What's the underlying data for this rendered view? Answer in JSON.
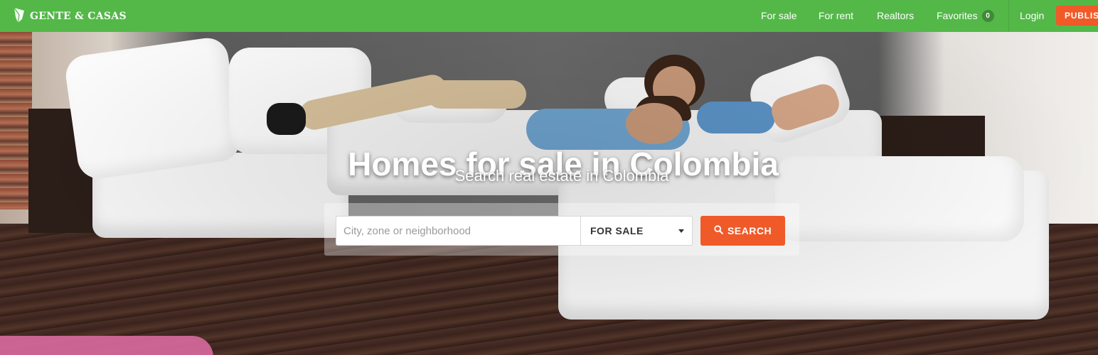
{
  "brand": {
    "name": "GENTE & CASAS",
    "icon": "leaf-logo-icon"
  },
  "nav": {
    "for_sale": "For sale",
    "for_rent": "For rent",
    "realtors": "Realtors",
    "favorites": "Favorites",
    "favorites_count": "0",
    "login": "Login",
    "publish": "PUBLISH"
  },
  "hero": {
    "title": "Homes for sale in Colombia",
    "subtitle": "Search real estate in Colombia"
  },
  "search": {
    "placeholder": "City, zone or neighborhood",
    "value": "",
    "type_selected": "FOR SALE",
    "button_label": "SEARCH",
    "button_icon": "search-icon"
  },
  "colors": {
    "navbar": "#53b848",
    "accent": "#f05a28",
    "badge": "#3f8a36"
  }
}
